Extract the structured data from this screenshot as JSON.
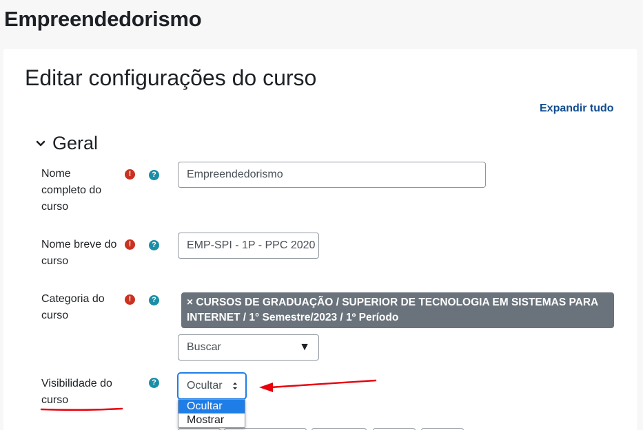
{
  "page": {
    "heading": "Empreendedorismo"
  },
  "card": {
    "title": "Editar configurações do curso",
    "expand_all": "Expandir tudo"
  },
  "section": {
    "title": "Geral"
  },
  "fields": {
    "fullname": {
      "label_lines": [
        "Nome",
        "completo do",
        "curso"
      ],
      "value": "Empreendedorismo"
    },
    "shortname": {
      "label_lines": [
        "Nome breve do",
        "curso"
      ],
      "value": "EMP-SPI - 1P - PPC 2020"
    },
    "category": {
      "label_lines": [
        "Categoria do",
        "curso"
      ],
      "selected_remove": "×",
      "selected_line1": "CURSOS DE GRADUAÇÃO / SUPERIOR DE TECNOLOGIA EM SISTEMAS PARA",
      "selected_line2": "INTERNET / 1° Semestre/2023 / 1º Período",
      "search_placeholder": "Buscar",
      "search_arrow": "▼"
    },
    "visibility": {
      "label_lines": [
        "Visibilidade do",
        "curso"
      ],
      "value": "Ocultar",
      "options": [
        "Ocultar",
        "Mostrar"
      ],
      "selected_index": 0
    }
  },
  "icons": {
    "required": "!",
    "help": "?"
  },
  "colors": {
    "required": "#ca3120",
    "help": "#1b8ea6",
    "link": "#0f4c8f",
    "badge": "#6a737b",
    "annotation": "#e8000b",
    "option_highlight": "#1e7de6"
  }
}
